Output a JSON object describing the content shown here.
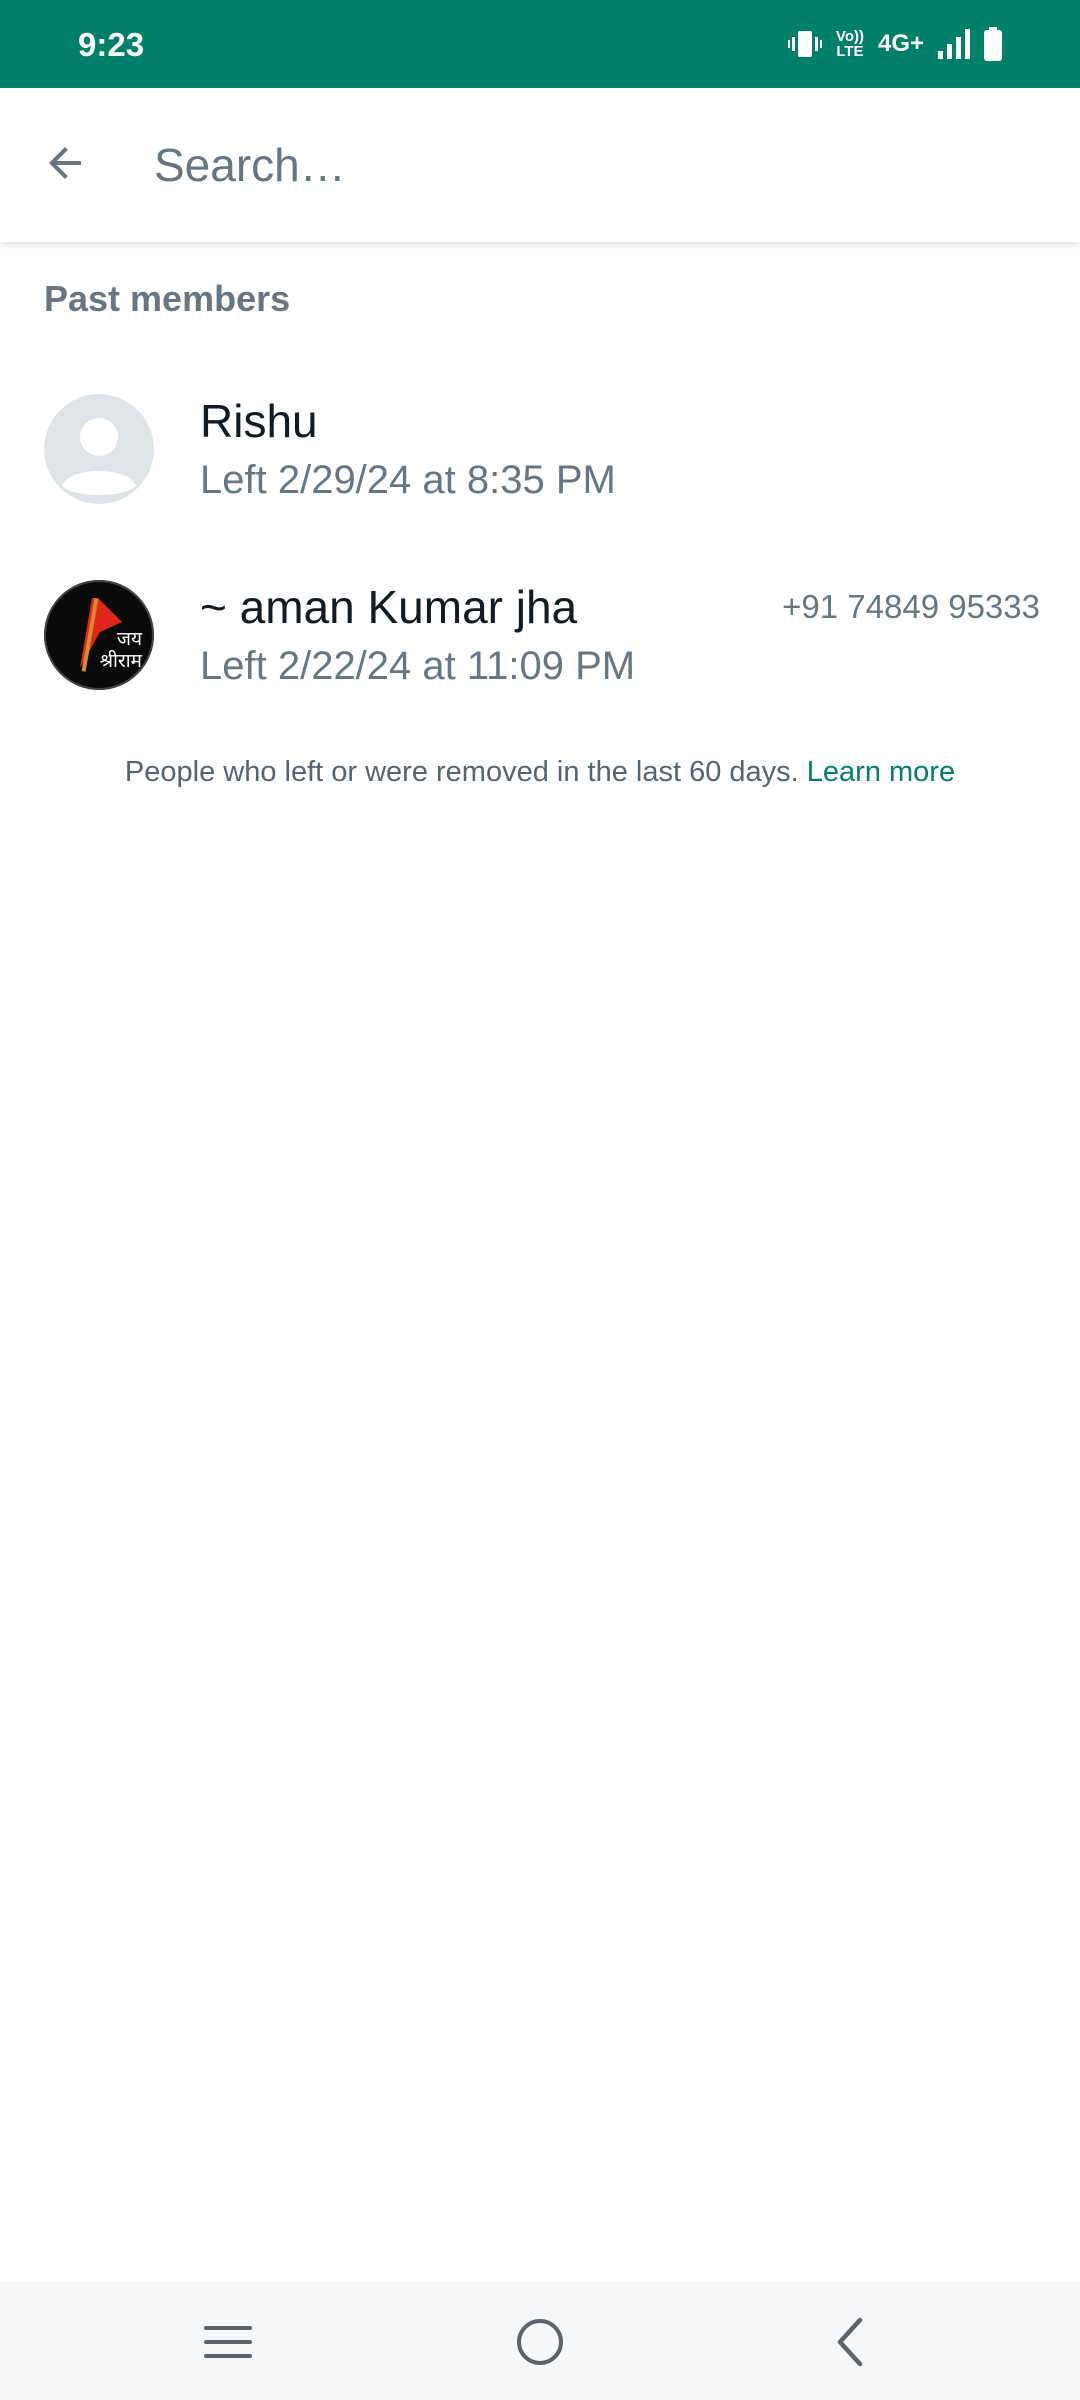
{
  "status_bar": {
    "time": "9:23",
    "network": "4G+",
    "volte_top": "Vo))",
    "volte_bottom": "LTE",
    "bg_color": "#008069"
  },
  "search": {
    "placeholder": "Search…",
    "value": "",
    "back_icon": "arrow-left-icon"
  },
  "section": {
    "title": "Past members"
  },
  "members": [
    {
      "name": "Rishu",
      "status": "Left 2/29/24 at 8:35 PM",
      "phone": "",
      "avatar": "default-person-avatar"
    },
    {
      "name": "~ aman Kumar jha",
      "status": "Left 2/22/24 at 11:09 PM",
      "phone": "+91 74849 95333",
      "avatar": "photo-avatar",
      "avatar_text": "जय श्रीराम"
    }
  ],
  "footer": {
    "note": "People who left or were removed in the last 60 days.",
    "link": "Learn more",
    "link_color": "#008069"
  },
  "nav": {
    "menu_icon": "recent-apps-icon",
    "home_icon": "home-circle-icon",
    "back_icon": "back-chevron-icon"
  }
}
